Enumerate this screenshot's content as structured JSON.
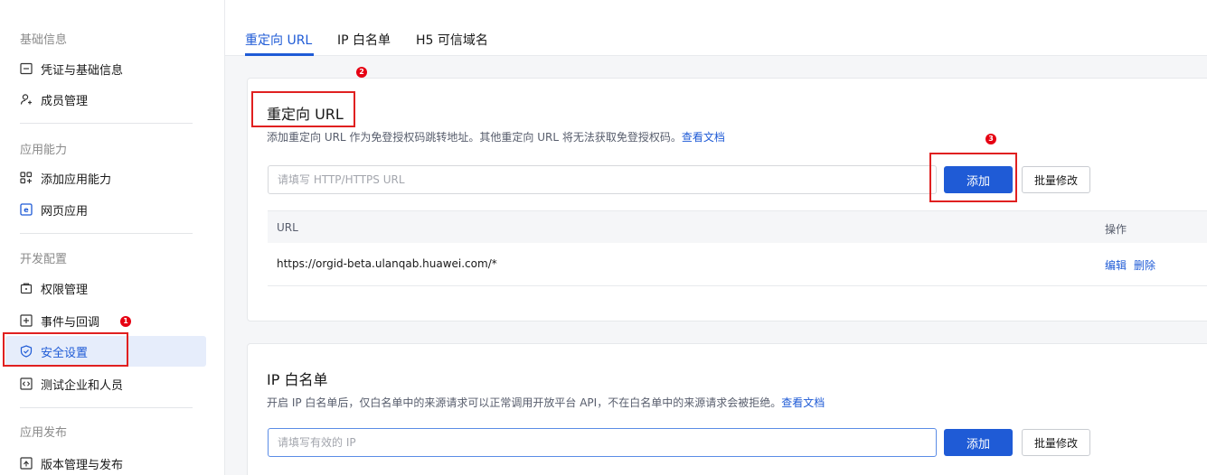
{
  "sidebar": {
    "groups": [
      {
        "title": "基础信息"
      },
      {
        "title": "应用能力"
      },
      {
        "title": "开发配置"
      },
      {
        "title": "应用发布"
      }
    ],
    "items": [
      {
        "label": "凭证与基础信息",
        "icon": "credential-icon"
      },
      {
        "label": "成员管理",
        "icon": "member-add-icon"
      },
      {
        "label": "添加应用能力",
        "icon": "app-grid-add-icon"
      },
      {
        "label": "网页应用",
        "icon": "web-app-icon"
      },
      {
        "label": "权限管理",
        "icon": "permission-icon"
      },
      {
        "label": "事件与回调",
        "icon": "event-callback-icon"
      },
      {
        "label": "安全设置",
        "icon": "shield-check-icon",
        "active": true
      },
      {
        "label": "测试企业和人员",
        "icon": "test-code-icon"
      },
      {
        "label": "版本管理与发布",
        "icon": "version-upload-icon"
      }
    ]
  },
  "tabs": [
    {
      "label": "重定向 URL",
      "active": true
    },
    {
      "label": "IP 白名单"
    },
    {
      "label": "H5 可信域名"
    }
  ],
  "redirect": {
    "title": "重定向 URL",
    "desc": "添加重定向 URL 作为免登授权码跳转地址。其他重定向 URL 将无法获取免登授权码。",
    "doc_link": "查看文档",
    "input_placeholder": "请填写 HTTP/HTTPS URL",
    "add_label": "添加",
    "batch_label": "批量修改",
    "table": {
      "headers": [
        "URL",
        "操作"
      ],
      "rows": [
        {
          "url": "https://orgid-beta.ulanqab.huawei.com/*",
          "edit": "编辑",
          "delete": "删除"
        }
      ]
    }
  },
  "whitelist": {
    "title": "IP 白名单",
    "desc": "开启 IP 白名单后，仅白名单中的来源请求可以正常调用开放平台 API，不在白名单中的来源请求会被拒绝。",
    "doc_link": "查看文档",
    "input_placeholder": "请填写有效的 IP",
    "add_label": "添加",
    "batch_label": "批量修改"
  },
  "annotations": [
    "1",
    "2",
    "3"
  ],
  "colors": {
    "accent": "#1f5bd6",
    "annotation": "#e02020",
    "active_bg": "#e6edfb"
  }
}
